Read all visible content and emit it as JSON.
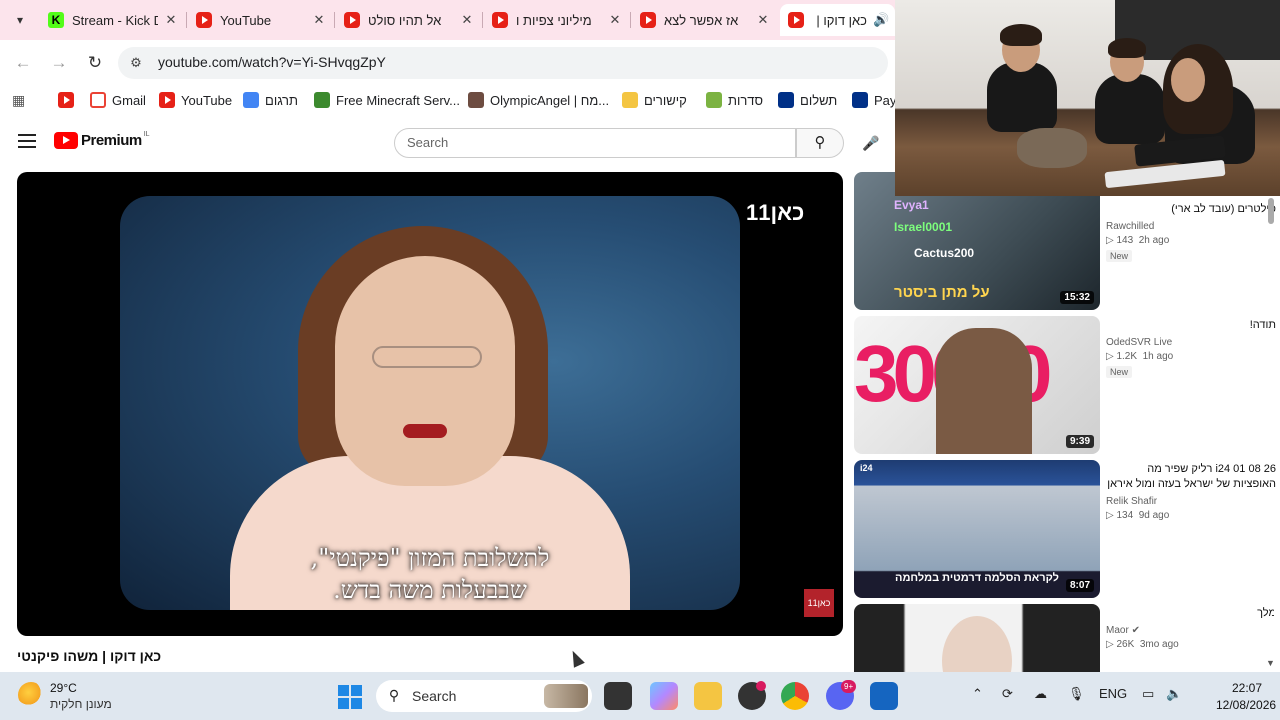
{
  "browser": {
    "tabs": [
      {
        "label": "Stream - Kick D",
        "icon": "kick-icon",
        "active": false
      },
      {
        "label": "YouTube",
        "icon": "youtube-icon",
        "active": false
      },
      {
        "label": "אל תהיו סולט",
        "icon": "youtube-icon",
        "active": false
      },
      {
        "label": "מיליוני צפיות ו",
        "icon": "youtube-icon",
        "active": false
      },
      {
        "label": "אז אפשר לצא",
        "icon": "youtube-icon",
        "active": false
      },
      {
        "label": "כאן דוקו | מ",
        "icon": "youtube-icon",
        "active": true
      }
    ],
    "url": "youtube.com/watch?v=Yi-SHvqgZpY",
    "bookmarks": [
      {
        "label": "",
        "icon": "youtube-icon"
      },
      {
        "label": "Gmail",
        "icon": "gmail-icon"
      },
      {
        "label": "YouTube",
        "icon": "youtube-icon"
      },
      {
        "label": "תרגום",
        "icon": "translate-icon"
      },
      {
        "label": "Free Minecraft Serv...",
        "icon": "minecraft-icon"
      },
      {
        "label": "OlympicAngel | מח...",
        "icon": "avatar-icon"
      },
      {
        "label": "קישורים",
        "icon": "folder-icon"
      },
      {
        "label": "סדרות",
        "icon": "tv-icon"
      },
      {
        "label": "תשלום",
        "icon": "paypal-icon"
      },
      {
        "label": "PayP",
        "icon": "paypal-icon"
      }
    ]
  },
  "youtube": {
    "logo_text": "Premium",
    "country_code": "IL",
    "search_placeholder": "Search",
    "video": {
      "title": "כאן דוקו | משהו פיקנטי",
      "subtitle_line1": "לתשלובת המזון \"פיקנטי\",",
      "subtitle_line2": "שבבעלות משה בדש.",
      "channel_logo": "כאן11",
      "corner_badge": "כאן11"
    },
    "recommendations": [
      {
        "title": "פילטרים (עובד לב ארי)",
        "channel": "Rawchilled",
        "views": "143",
        "age": "2h ago",
        "badge": "New",
        "duration": "15:32",
        "thumb_text": "על מתן ביסטר",
        "overlay_chat": [
          "Evya1",
          "Israel0001",
          "Cactus200"
        ]
      },
      {
        "title": "תודה!",
        "channel": "OdedSVR Live",
        "views": "1.2K",
        "age": "1h ago",
        "badge": "New",
        "duration": "9:39",
        "thumb_text": "30000"
      },
      {
        "title": "i24 01 08 26 רליק שפיר מה האופציות של ישראל בעזה ומול איראן",
        "channel": "Relik Shafir",
        "views": "134",
        "age": "9d ago",
        "badge": "",
        "duration": "8:07",
        "thumb_text": "לקראת הסלמה דרמטית במלחמה"
      },
      {
        "title": "מלך",
        "channel": "Maor",
        "views": "26K",
        "age": "3mo ago",
        "badge": "",
        "duration": "",
        "thumb_text": ""
      }
    ]
  },
  "taskbar": {
    "weather_temp": "29°C",
    "weather_desc": "מעונן חלקית",
    "search_label": "Search",
    "language": "ENG",
    "time": "22:07",
    "date": "12/08/2026",
    "discord_badge": "9+"
  },
  "colors": {
    "youtube_red": "#ff0000",
    "tab_strip": "#fce4ec",
    "taskbar": "#dfe7ef"
  }
}
